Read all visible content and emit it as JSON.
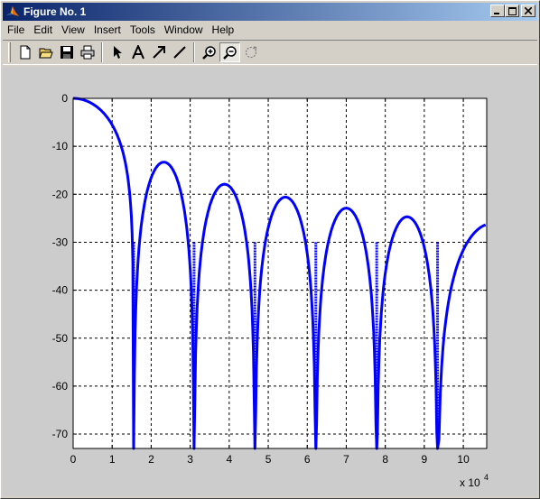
{
  "window": {
    "title": "Figure No. 1",
    "minimize_label": "_",
    "maximize_label": "□",
    "close_label": "✕"
  },
  "menu": [
    {
      "label": "File"
    },
    {
      "label": "Edit"
    },
    {
      "label": "View"
    },
    {
      "label": "Insert"
    },
    {
      "label": "Tools"
    },
    {
      "label": "Window"
    },
    {
      "label": "Help"
    }
  ],
  "toolbar": {
    "buttons": [
      {
        "name": "new-figure",
        "icon": "new-file-icon"
      },
      {
        "name": "open-file",
        "icon": "folder-open-icon"
      },
      {
        "name": "save",
        "icon": "floppy-disk-icon"
      },
      {
        "name": "print",
        "icon": "printer-icon"
      },
      {
        "name": "edit-plot",
        "icon": "arrow-cursor-icon"
      },
      {
        "name": "insert-text",
        "icon": "text-a-icon"
      },
      {
        "name": "insert-arrow",
        "icon": "diagonal-arrow-icon"
      },
      {
        "name": "insert-line",
        "icon": "line-icon"
      },
      {
        "name": "zoom-in",
        "icon": "zoom-in-icon"
      },
      {
        "name": "zoom-out",
        "icon": "zoom-out-icon",
        "pressed": true
      },
      {
        "name": "rotate-3d",
        "icon": "rotate-icon"
      }
    ]
  },
  "chart_data": {
    "type": "line",
    "title": "",
    "xlabel": "",
    "ylabel": "",
    "x_exponent_label": "x 10",
    "x_exponent": "4",
    "xlim": [
      0,
      10.6
    ],
    "ylim": [
      -73,
      0
    ],
    "xticks": [
      0,
      1,
      2,
      3,
      4,
      5,
      6,
      7,
      8,
      9,
      10
    ],
    "yticks": [
      0,
      -10,
      -20,
      -30,
      -40,
      -50,
      -60,
      -70
    ],
    "grid": true,
    "line_color": "#0000ff",
    "series": [
      {
        "description_of_shape": "sinc-like magnitude in dB",
        "lobe_nulls_x": [
          1.55,
          3.1,
          4.66,
          6.22,
          7.78,
          9.34
        ],
        "lobe_peaks": [
          {
            "x": 0,
            "y": 0
          },
          {
            "x": 2.2,
            "y": -13.3
          },
          {
            "x": 3.83,
            "y": -17.9
          },
          {
            "x": 5.4,
            "y": -20.6
          },
          {
            "x": 6.98,
            "y": -22.9
          },
          {
            "x": 8.55,
            "y": -24.7
          },
          {
            "x": 10.12,
            "y": -26.1
          }
        ],
        "end_point": {
          "x": 10.6,
          "y": -31.5
        }
      }
    ]
  }
}
